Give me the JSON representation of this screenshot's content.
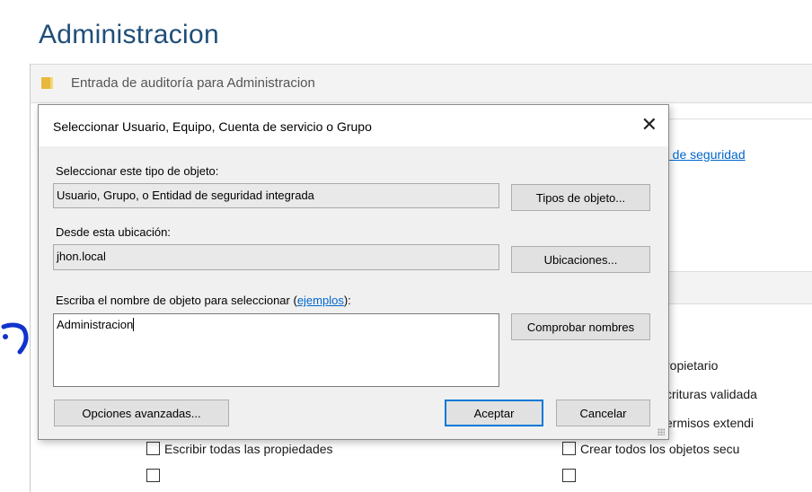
{
  "page": {
    "title": "Administracion"
  },
  "background_window": {
    "title": "Entrada de auditoría para Administracion",
    "link_fragment": "d de seguridad",
    "permission_fragments": [
      "ropietario",
      "crituras validada",
      "ermisos extendi"
    ],
    "checkboxes": [
      "Escribir todas las propiedades",
      "Crear todos los objetos secu"
    ]
  },
  "dialog": {
    "title": "Seleccionar Usuario, Equipo, Cuenta de servicio o Grupo",
    "object_type_label": "Seleccionar este tipo de objeto:",
    "object_type_value": "Usuario, Grupo, o Entidad de seguridad integrada",
    "object_types_button": "Tipos de objeto...",
    "location_label": "Desde esta ubicación:",
    "location_value": "jhon.local",
    "locations_button": "Ubicaciones...",
    "name_label_prefix": "Escriba el nombre de objeto para seleccionar (",
    "examples_link": "ejemplos",
    "name_label_suffix": "):",
    "name_value": "Administracion",
    "check_names_button": "Comprobar nombres",
    "advanced_button": "Opciones avanzadas...",
    "ok_button": "Aceptar",
    "cancel_button": "Cancelar"
  },
  "colors": {
    "accent": "#0078d7",
    "title": "#1f4e79",
    "link": "#0066cc"
  }
}
